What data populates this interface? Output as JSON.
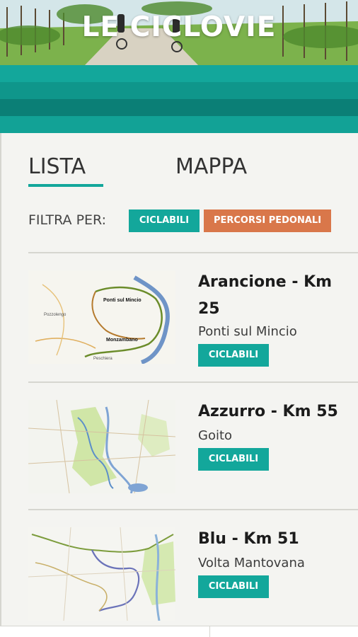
{
  "header": {
    "title": "LE CICLOVIE"
  },
  "tabs": {
    "lista": "LISTA",
    "mappa": "MAPPA"
  },
  "filter": {
    "label": "FILTRA PER:",
    "cycle_label": "CICLABILI",
    "walk_label": "PERCORSI PEDONALI"
  },
  "colors": {
    "teal": "#13a79b",
    "orange": "#d9774a",
    "panel": "#f4f4f1"
  },
  "routes": [
    {
      "title": "Arancione - Km 25",
      "place": "Ponti sul Mincio",
      "badge": "CICLABILI",
      "map_labels": [
        "Ponti sul Mincio",
        "Monzambano",
        "Pozzolengo",
        "Peschiera"
      ]
    },
    {
      "title": "Azzurro - Km 55",
      "place": "Goito",
      "badge": "CICLABILI"
    },
    {
      "title": "Blu - Km 51",
      "place": "Volta Mantovana",
      "badge": "CICLABILI"
    }
  ]
}
